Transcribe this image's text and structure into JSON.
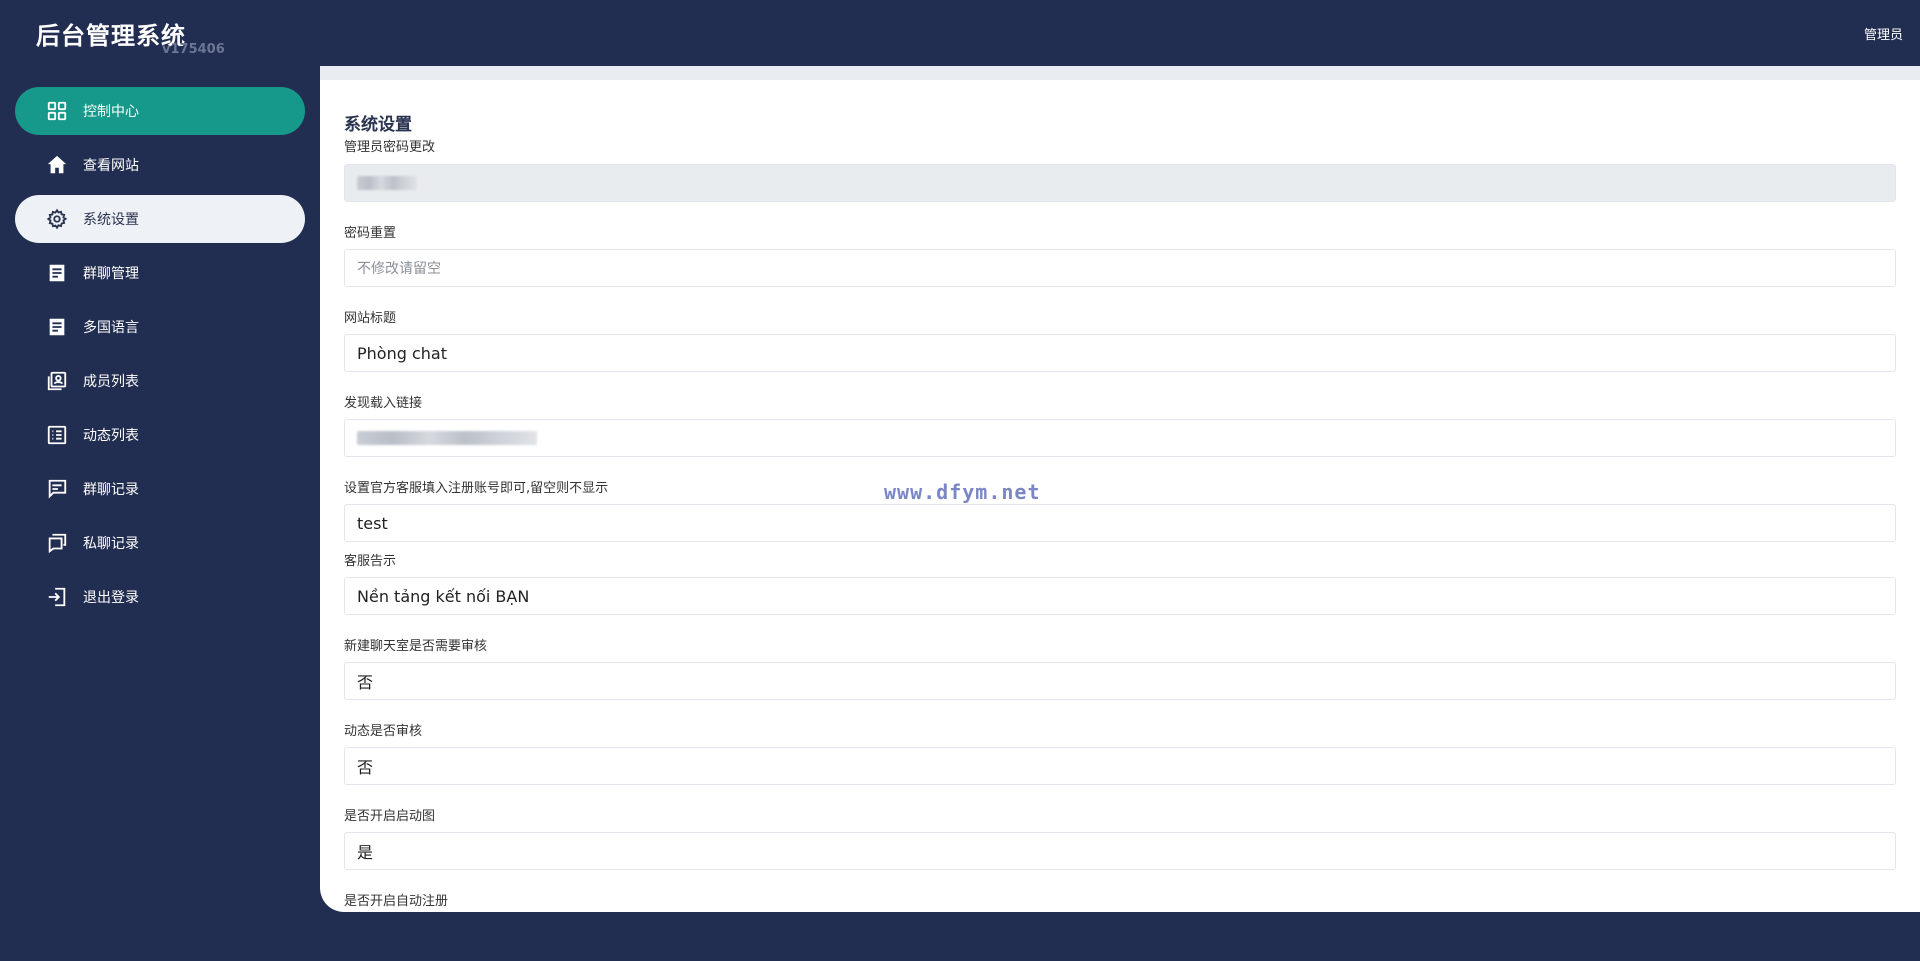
{
  "brand": {
    "title": "后台管理系统",
    "version": "v175406"
  },
  "header": {
    "user_label": "管理员"
  },
  "sidebar": {
    "items": [
      {
        "label": "控制中心",
        "icon": "grid-icon"
      },
      {
        "label": "查看网站",
        "icon": "home-icon"
      },
      {
        "label": "系统设置",
        "icon": "gear-icon"
      },
      {
        "label": "群聊管理",
        "icon": "document-icon"
      },
      {
        "label": "多国语言",
        "icon": "document-icon"
      },
      {
        "label": "成员列表",
        "icon": "contacts-icon"
      },
      {
        "label": "动态列表",
        "icon": "list-icon"
      },
      {
        "label": "群聊记录",
        "icon": "chat-icon"
      },
      {
        "label": "私聊记录",
        "icon": "chats-icon"
      },
      {
        "label": "退出登录",
        "icon": "logout-icon"
      }
    ]
  },
  "colors": {
    "background": "#222e51",
    "accent": "#16998a",
    "active_bg": "#eef1f5"
  },
  "main": {
    "section_title": "系统设置",
    "fields": [
      {
        "label": "管理员密码更改",
        "value": ""
      },
      {
        "label": "密码重置",
        "placeholder": "不修改请留空",
        "value": ""
      },
      {
        "label": "网站标题",
        "value": "Phòng chat"
      },
      {
        "label": "发现载入链接",
        "value": ""
      },
      {
        "label": "设置官方客服填入注册账号即可,留空则不显示",
        "value": "test"
      },
      {
        "label": "客服告示",
        "value": "Nền tảng kết nối BẠN"
      },
      {
        "label": "新建聊天室是否需要审核",
        "value": "否"
      },
      {
        "label": "动态是否审核",
        "value": "否"
      },
      {
        "label": "是否开启启动图",
        "value": "是"
      },
      {
        "label": "是否开启自动注册"
      }
    ]
  },
  "watermark": "www.dfym.net"
}
